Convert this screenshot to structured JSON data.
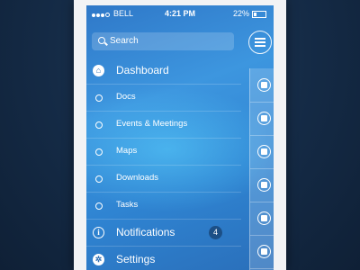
{
  "status_bar": {
    "carrier": "BELL",
    "time": "4:21 PM",
    "battery": "22%"
  },
  "search": {
    "placeholder": "Search"
  },
  "menu": {
    "items": [
      {
        "label": "Dashboard",
        "kind": "main",
        "icon": "home-icon"
      },
      {
        "label": "Docs",
        "kind": "sub"
      },
      {
        "label": "Events & Meetings",
        "kind": "sub"
      },
      {
        "label": "Maps",
        "kind": "sub"
      },
      {
        "label": "Downloads",
        "kind": "sub"
      },
      {
        "label": "Tasks",
        "kind": "sub"
      },
      {
        "label": "Notifications",
        "kind": "main",
        "icon": "info-icon",
        "badge": "4"
      },
      {
        "label": "Settings",
        "kind": "main",
        "icon": "gear-icon"
      }
    ]
  },
  "right_rail": {
    "icons": [
      "window-icon",
      "calendar-icon",
      "map-pin-icon",
      "cloud-icon",
      "check-icon",
      "briefcase-icon"
    ]
  },
  "colors": {
    "background": "#142a45",
    "screen_blue": "#3d96df",
    "badge": "#1c4f86"
  }
}
